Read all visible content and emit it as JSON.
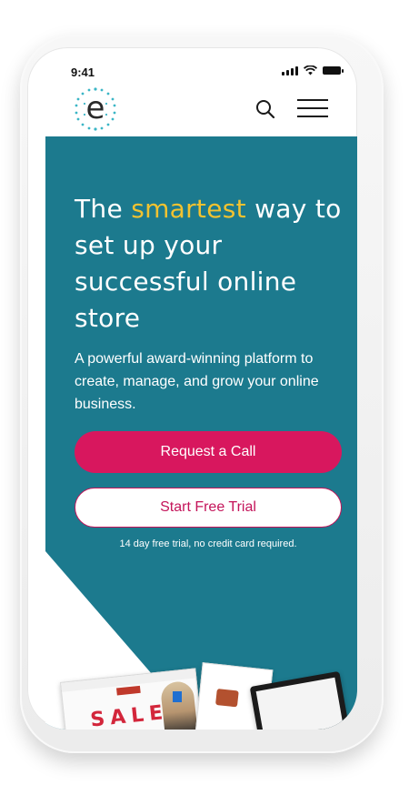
{
  "status_bar": {
    "time": "9:41"
  },
  "header": {
    "logo_letter": "e",
    "search_icon": "search-icon",
    "menu_icon": "hamburger-menu-icon"
  },
  "hero": {
    "headline_pre": "The ",
    "headline_highlight": "smartest",
    "headline_post": " way to set up your successful online store",
    "subtext": "A powerful award-winning platform to create, manage, and grow your online business.",
    "primary_button": "Request a Call",
    "secondary_button": "Start Free Trial",
    "trial_note": "14 day free trial, no credit card required.",
    "preview_sale_text": "SALE"
  },
  "colors": {
    "hero_background": "#1c7a8e",
    "highlight": "#f2c230",
    "primary_button": "#d8175e",
    "secondary_border": "#c4145a"
  }
}
